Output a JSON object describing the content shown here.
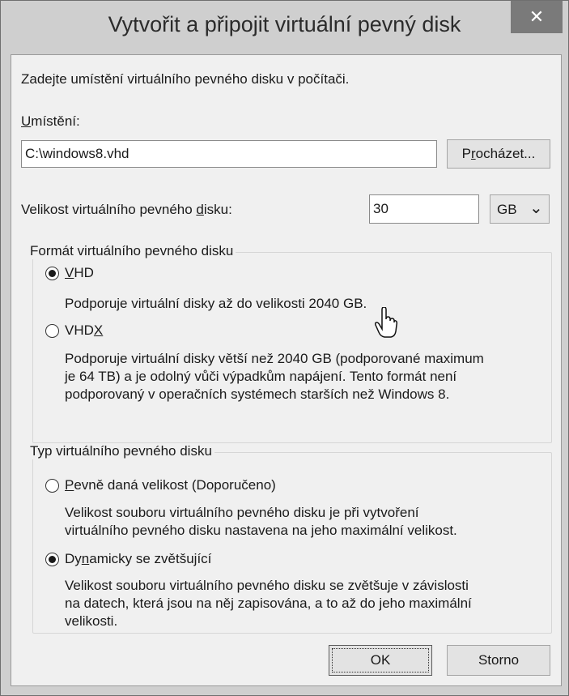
{
  "window": {
    "title": "Vytvořit a připojit virtuální pevný disk",
    "close": "✕"
  },
  "intro": "Zadejte umístění virtuálního pevného disku v počítači.",
  "location": {
    "label_u": "U",
    "label_rest": "místění:",
    "value": "C:\\windows8.vhd",
    "browse_pre": "P",
    "browse_u": "r",
    "browse_post": "ocházet..."
  },
  "size": {
    "label_pre": "Velikost virtuálního pevného ",
    "label_u": "d",
    "label_post": "isku:",
    "value": "30",
    "unit": "GB",
    "chevron": "⌄"
  },
  "format": {
    "legend": "Formát virtuálního pevného disku",
    "vhd_u": "V",
    "vhd_rest": "HD",
    "vhd_desc": "Podporuje virtuální disky až do velikosti 2040 GB.",
    "vhdx_pre": "VHD",
    "vhdx_u": "X",
    "vhdx_desc": "Podporuje virtuální disky větší než 2040 GB (podporované maximum\nje 64 TB) a je odolný vůči výpadkům napájení. Tento formát není\npodporovaný v operačních systémech starších než Windows 8."
  },
  "type": {
    "legend": "Typ virtuálního pevného disku",
    "fixed_u": "P",
    "fixed_rest": "evně daná velikost (Doporučeno)",
    "fixed_desc": "Velikost souboru virtuálního pevného disku je při vytvoření\nvirtuálního pevného disku nastavena na jeho maximální velikost.",
    "dyn_pre": "Dy",
    "dyn_u": "n",
    "dyn_post": "amicky se zvětšující",
    "dyn_desc": "Velikost souboru virtuálního pevného disku se zvětšuje v závislosti\nna datech, která jsou na něj zapisována, a to až do jeho maximální\nvelikosti."
  },
  "buttons": {
    "ok": "OK",
    "cancel": "Storno"
  },
  "selected": {
    "format": "VHD",
    "type": "Dynamicky se zvětšující"
  }
}
